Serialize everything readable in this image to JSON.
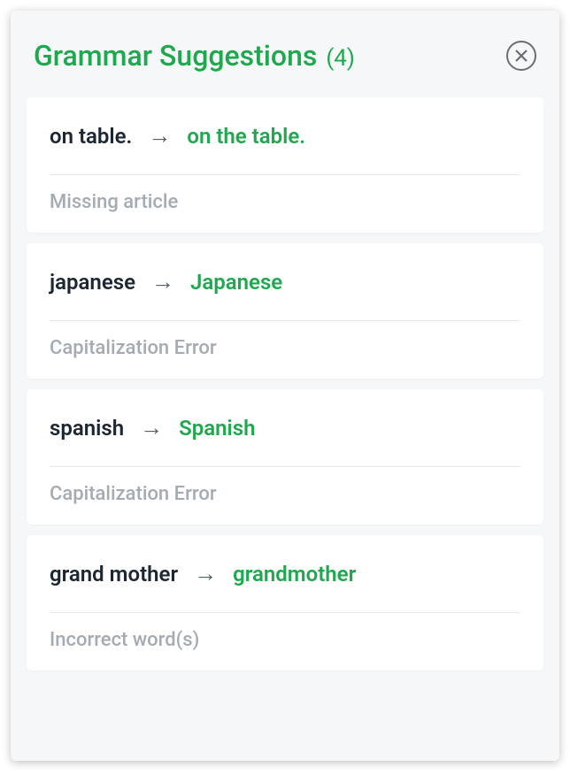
{
  "header": {
    "title": "Grammar Suggestions",
    "count": "(4)"
  },
  "suggestions": [
    {
      "original": "on table.",
      "corrected": "on the table.",
      "type": "Missing article"
    },
    {
      "original": "japanese",
      "corrected": "Japanese",
      "type": "Capitalization Error"
    },
    {
      "original": "spanish",
      "corrected": "Spanish",
      "type": "Capitalization Error"
    },
    {
      "original": "grand mother",
      "corrected": "grandmother",
      "type": "Incorrect word(s)"
    }
  ]
}
